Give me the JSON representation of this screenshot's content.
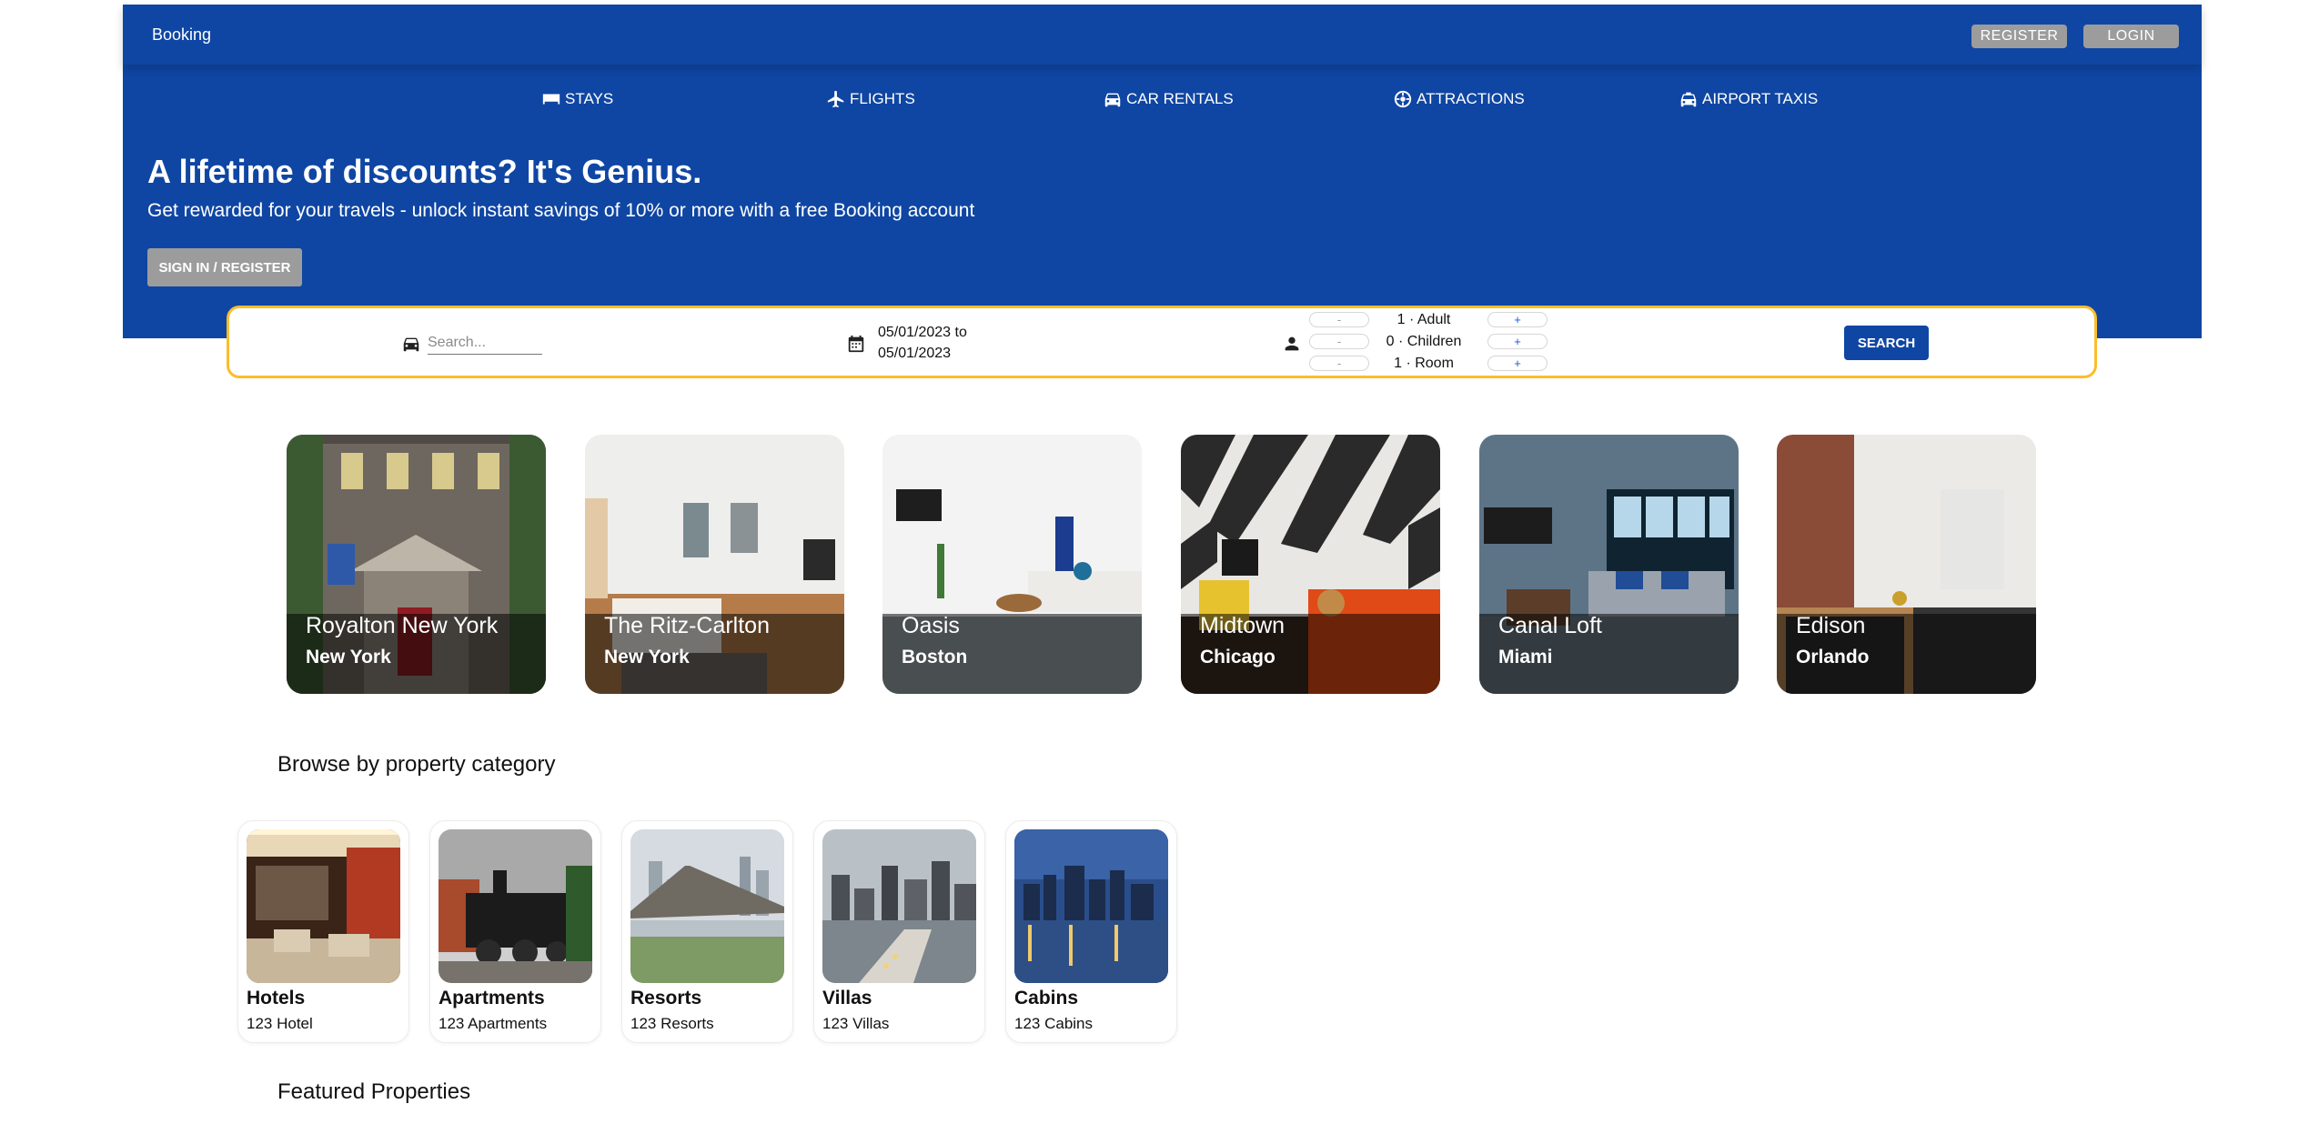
{
  "header": {
    "brand": "Booking",
    "register_label": "REGISTER",
    "login_label": "LOGIN",
    "nav": [
      {
        "label": "STAYS",
        "icon": "bed-icon"
      },
      {
        "label": "FLIGHTS",
        "icon": "plane-icon"
      },
      {
        "label": "CAR RENTALS",
        "icon": "car-icon"
      },
      {
        "label": "ATTRACTIONS",
        "icon": "attraction-icon"
      },
      {
        "label": "AIRPORT TAXIS",
        "icon": "taxi-icon"
      }
    ],
    "title": "A lifetime of discounts? It's Genius.",
    "subtitle": "Get rewarded for your travels - unlock instant savings of 10% or more with a free Booking account",
    "cta_label": "SIGN IN / REGISTER"
  },
  "search": {
    "placeholder": "Search...",
    "date_start": "05/01/2023 to",
    "date_end": "05/01/2023",
    "minus": "-",
    "plus": "+",
    "adult": "1 · Adult",
    "children": "0 · Children",
    "room": "1 · Room",
    "button_label": "SEARCH"
  },
  "cities": [
    {
      "name": "Royalton New York",
      "city": "New York"
    },
    {
      "name": "The Ritz-Carlton",
      "city": "New York"
    },
    {
      "name": "Oasis",
      "city": "Boston"
    },
    {
      "name": "Midtown",
      "city": "Chicago"
    },
    {
      "name": "Canal Loft",
      "city": "Miami"
    },
    {
      "name": "Edison",
      "city": "Orlando"
    }
  ],
  "categories_title": "Browse by property category",
  "categories": [
    {
      "name": "Hotels",
      "count": "123 Hotel"
    },
    {
      "name": "Apartments",
      "count": "123 Apartments"
    },
    {
      "name": "Resorts",
      "count": "123 Resorts"
    },
    {
      "name": "Villas",
      "count": "123 Villas"
    },
    {
      "name": "Cabins",
      "count": "123 Cabins"
    }
  ],
  "featured_title": "Featured Properties",
  "colors": {
    "brand_blue": "#0f46a3",
    "search_border": "#fbbd2b",
    "button_gray": "#9c9c9c"
  }
}
